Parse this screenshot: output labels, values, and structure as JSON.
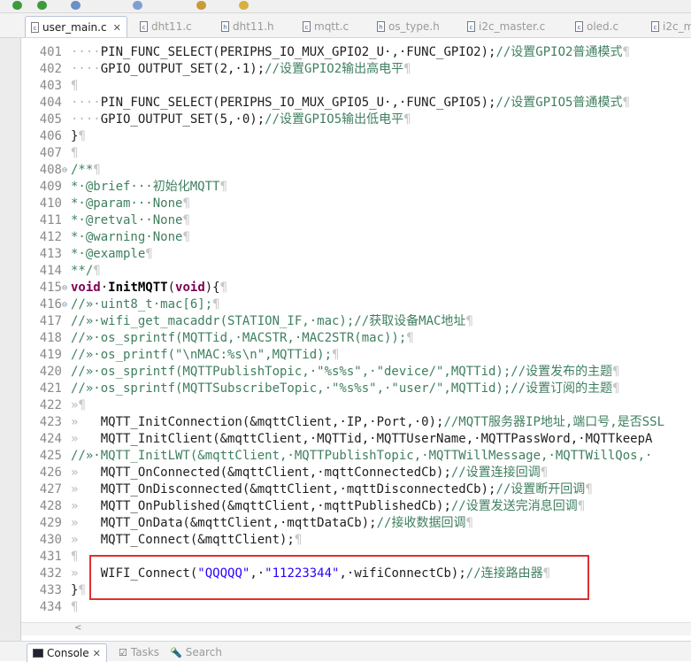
{
  "tabs": [
    {
      "label": "user_main.c",
      "active": true
    },
    {
      "label": "dht11.c"
    },
    {
      "label": "dht11.h"
    },
    {
      "label": "mqtt.c"
    },
    {
      "label": "os_type.h"
    },
    {
      "label": "i2c_master.c"
    },
    {
      "label": "oled.c"
    },
    {
      "label": "i2c_m"
    }
  ],
  "lines": [
    {
      "n": "401",
      "segs": [
        [
          "ws",
          "····"
        ],
        [
          "code",
          "PIN_FUNC_SELECT(PERIPHS_IO_MUX_GPIO2_U·,·FUNC_GPIO2);"
        ],
        [
          "cm",
          "//设置GPIO2普通模式"
        ],
        [
          "pil",
          "¶"
        ]
      ]
    },
    {
      "n": "402",
      "segs": [
        [
          "ws",
          "····"
        ],
        [
          "code",
          "GPIO_OUTPUT_SET(2,·1);"
        ],
        [
          "cm",
          "//设置GPIO2输出高电平"
        ],
        [
          "pil",
          "¶"
        ]
      ]
    },
    {
      "n": "403",
      "segs": [
        [
          "pil",
          "¶"
        ]
      ]
    },
    {
      "n": "404",
      "segs": [
        [
          "ws",
          "····"
        ],
        [
          "code",
          "PIN_FUNC_SELECT(PERIPHS_IO_MUX_GPIO5_U·,·FUNC_GPIO5);"
        ],
        [
          "cm",
          "//设置GPIO5普通模式"
        ],
        [
          "pil",
          "¶"
        ]
      ]
    },
    {
      "n": "405",
      "segs": [
        [
          "ws",
          "····"
        ],
        [
          "code",
          "GPIO_OUTPUT_SET(5,·0);"
        ],
        [
          "cm",
          "//设置GPIO5输出低电平"
        ],
        [
          "pil",
          "¶"
        ]
      ]
    },
    {
      "n": "406",
      "segs": [
        [
          "code",
          "}"
        ],
        [
          "pil",
          "¶"
        ]
      ]
    },
    {
      "n": "407",
      "segs": [
        [
          "pil",
          "¶"
        ]
      ]
    },
    {
      "n": "408",
      "fold": true,
      "segs": [
        [
          "cm",
          "/**"
        ],
        [
          "pil",
          "¶"
        ]
      ]
    },
    {
      "n": "409",
      "segs": [
        [
          "cm",
          "*·@brief···初始化MQTT"
        ],
        [
          "pil",
          "¶"
        ]
      ]
    },
    {
      "n": "410",
      "segs": [
        [
          "cm",
          "*·@param···None"
        ],
        [
          "pil",
          "¶"
        ]
      ]
    },
    {
      "n": "411",
      "segs": [
        [
          "cm",
          "*·@retval··None"
        ],
        [
          "pil",
          "¶"
        ]
      ]
    },
    {
      "n": "412",
      "segs": [
        [
          "cm",
          "*·@warning·None"
        ],
        [
          "pil",
          "¶"
        ]
      ]
    },
    {
      "n": "413",
      "segs": [
        [
          "cm",
          "*·@example"
        ],
        [
          "pil",
          "¶"
        ]
      ]
    },
    {
      "n": "414",
      "segs": [
        [
          "cm",
          "**/"
        ],
        [
          "pil",
          "¶"
        ]
      ]
    },
    {
      "n": "415",
      "fold": true,
      "segs": [
        [
          "kw",
          "void"
        ],
        [
          "code",
          "·"
        ],
        [
          "fn",
          "InitMQTT"
        ],
        [
          "code",
          "("
        ],
        [
          "kw",
          "void"
        ],
        [
          "code",
          "){"
        ],
        [
          "pil",
          "¶"
        ]
      ]
    },
    {
      "n": "416",
      "fold": true,
      "segs": [
        [
          "cm",
          "//»·uint8_t·mac[6];"
        ],
        [
          "pil",
          "¶"
        ]
      ]
    },
    {
      "n": "417",
      "segs": [
        [
          "cm",
          "//»·wifi_get_macaddr(STATION_IF,·mac);//获取设备MAC地址"
        ],
        [
          "pil",
          "¶"
        ]
      ]
    },
    {
      "n": "418",
      "segs": [
        [
          "cm",
          "//»·os_sprintf(MQTTid,·MACSTR,·MAC2STR(mac));"
        ],
        [
          "pil",
          "¶"
        ]
      ]
    },
    {
      "n": "419",
      "segs": [
        [
          "cm",
          "//»·os_printf(\"\\nMAC:%s\\n\",MQTTid);"
        ],
        [
          "pil",
          "¶"
        ]
      ]
    },
    {
      "n": "420",
      "segs": [
        [
          "cm",
          "//»·os_sprintf(MQTTPublishTopic,·\"%s%s\",·\"device/\",MQTTid);//设置发布的主题"
        ],
        [
          "pil",
          "¶"
        ]
      ]
    },
    {
      "n": "421",
      "segs": [
        [
          "cm",
          "//»·os_sprintf(MQTTSubscribeTopic,·\"%s%s\",·\"user/\",MQTTid);//设置订阅的主题"
        ],
        [
          "pil",
          "¶"
        ]
      ]
    },
    {
      "n": "422",
      "segs": [
        [
          "ws",
          "»"
        ],
        [
          "pil",
          "¶"
        ]
      ]
    },
    {
      "n": "423",
      "segs": [
        [
          "ws",
          "»   "
        ],
        [
          "code",
          "MQTT_InitConnection(&mqttClient,·IP,·Port,·0);"
        ],
        [
          "cm",
          "//MQTT服务器IP地址,端口号,是否SSL"
        ]
      ]
    },
    {
      "n": "424",
      "segs": [
        [
          "ws",
          "»   "
        ],
        [
          "code",
          "MQTT_InitClient(&mqttClient,·MQTTid,·MQTTUserName,·MQTTPassWord,·MQTTkeepA"
        ]
      ]
    },
    {
      "n": "425",
      "segs": [
        [
          "cm",
          "//»·MQTT_InitLWT(&mqttClient,·MQTTPublishTopic,·MQTTWillMessage,·MQTTWillQos,·"
        ]
      ]
    },
    {
      "n": "426",
      "segs": [
        [
          "ws",
          "»   "
        ],
        [
          "code",
          "MQTT_OnConnected(&mqttClient,·mqttConnectedCb);"
        ],
        [
          "cm",
          "//设置连接回调"
        ],
        [
          "pil",
          "¶"
        ]
      ]
    },
    {
      "n": "427",
      "segs": [
        [
          "ws",
          "»   "
        ],
        [
          "code",
          "MQTT_OnDisconnected(&mqttClient,·mqttDisconnectedCb);"
        ],
        [
          "cm",
          "//设置断开回调"
        ],
        [
          "pil",
          "¶"
        ]
      ]
    },
    {
      "n": "428",
      "segs": [
        [
          "ws",
          "»   "
        ],
        [
          "code",
          "MQTT_OnPublished(&mqttClient,·mqttPublishedCb);"
        ],
        [
          "cm",
          "//设置发送完消息回调"
        ],
        [
          "pil",
          "¶"
        ]
      ]
    },
    {
      "n": "429",
      "segs": [
        [
          "ws",
          "»   "
        ],
        [
          "code",
          "MQTT_OnData(&mqttClient,·mqttDataCb);"
        ],
        [
          "cm",
          "//接收数据回调"
        ],
        [
          "pil",
          "¶"
        ]
      ]
    },
    {
      "n": "430",
      "segs": [
        [
          "ws",
          "»   "
        ],
        [
          "code",
          "MQTT_Connect(&mqttClient);"
        ],
        [
          "pil",
          "¶"
        ]
      ]
    },
    {
      "n": "431",
      "segs": [
        [
          "pil",
          "¶"
        ]
      ]
    },
    {
      "n": "432",
      "segs": [
        [
          "ws",
          "»   "
        ],
        [
          "code",
          "WIFI_Connect("
        ],
        [
          "str",
          "\"QQQQQ\""
        ],
        [
          "code",
          ",·"
        ],
        [
          "str",
          "\"11223344\""
        ],
        [
          "code",
          ",·wifiConnectCb);"
        ],
        [
          "cm",
          "//连接路由器"
        ],
        [
          "pil",
          "¶"
        ]
      ]
    },
    {
      "n": "433",
      "segs": [
        [
          "code",
          "}"
        ],
        [
          "pil",
          "¶"
        ]
      ]
    },
    {
      "n": "434",
      "segs": [
        [
          "pil",
          "¶"
        ]
      ]
    }
  ],
  "bottom_tabs": [
    {
      "label": "Console",
      "active": true
    },
    {
      "label": "Tasks"
    },
    {
      "label": "Search"
    }
  ]
}
